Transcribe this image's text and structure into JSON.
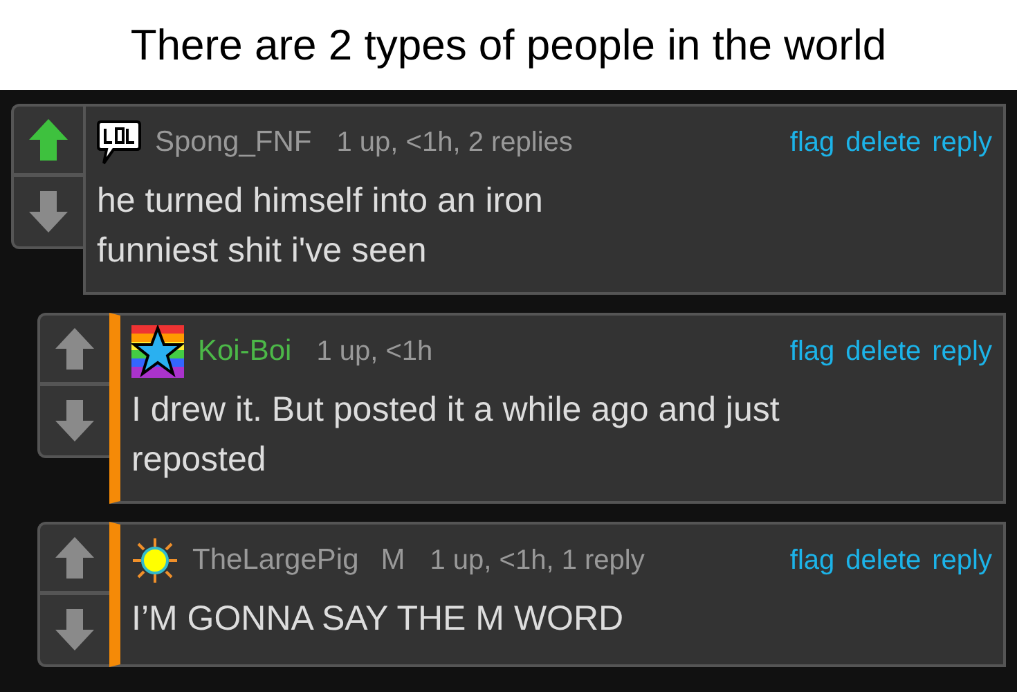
{
  "caption": "There are 2 types of people in the world",
  "comments": [
    {
      "kind": "lol",
      "username": "Spong_FNF",
      "color": "#999999",
      "meta": "1 up, <1h, 2 replies",
      "upvoted": true,
      "actions": [
        "flag",
        "delete",
        "reply"
      ],
      "lines": [
        "he turned himself into an iron",
        "funniest shit i've seen"
      ],
      "children": [
        {
          "kind": "star",
          "username": "Koi-Boi",
          "color": "#4cb848",
          "meta": "1 up, <1h",
          "upvoted": false,
          "actions": [
            "flag",
            "delete",
            "reply"
          ],
          "lines": [
            "I drew it. But posted it a while ago and just",
            "reposted"
          ]
        },
        {
          "kind": "sun",
          "username": "TheLargePig",
          "badge": "M",
          "color": "#999999",
          "meta": "1 up, <1h, 1 reply",
          "upvoted": false,
          "actions": [
            "flag",
            "delete",
            "reply"
          ],
          "lines": [
            "I’M GONNA SAY THE M WORD"
          ]
        }
      ]
    }
  ]
}
